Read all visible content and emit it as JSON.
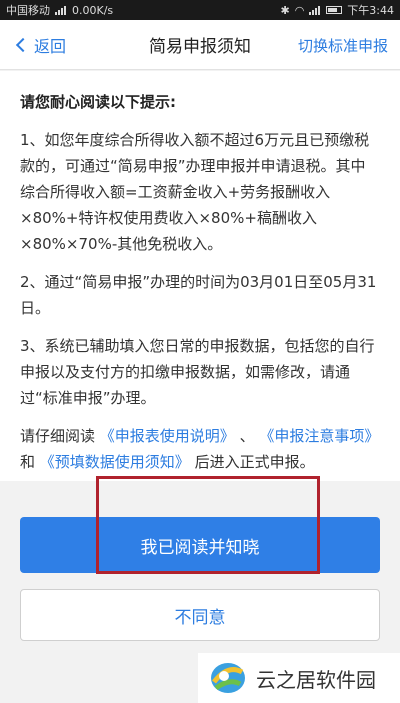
{
  "statusbar": {
    "carrier": "中国移动",
    "speed": "0.00K/s",
    "time": "下午3:44"
  },
  "navbar": {
    "back_label": "返回",
    "title": "简易申报须知",
    "right_label": "切换标准申报"
  },
  "content": {
    "heading": "请您耐心阅读以下提示:",
    "item1": "1、如您年度综合所得收入额不超过6万元且已预缴税款的，可通过“简易申报”办理申报并申请退税。其中综合所得收入额=工资薪金收入+劳务报酬收入×80%+特许权使用费收入×80%+稿酬收入×80%×70%-其他免税收入。",
    "item2": "2、通过“简易申报”办理的时间为03月01日至05月31日。",
    "item3": "3、系统已辅助填入您日常的申报数据，包括您的自行申报以及支付方的扣缴申报数据，如需修改，请通过“标准申报”办理。",
    "footer_prefix": "请仔细阅读",
    "link1": "《申报表使用说明》",
    "sep1": "、",
    "link2": "《申报注意事项》",
    "and": "和",
    "link3": "《预填数据使用须知》",
    "footer_suffix": "后进入正式申报。"
  },
  "buttons": {
    "agree": "我已阅读并知晓",
    "disagree": "不同意"
  },
  "watermark": {
    "text": "云之居软件园"
  },
  "colors": {
    "accent": "#2d7de0",
    "primary_button": "#2f7fe6",
    "highlight": "#b0222d"
  }
}
